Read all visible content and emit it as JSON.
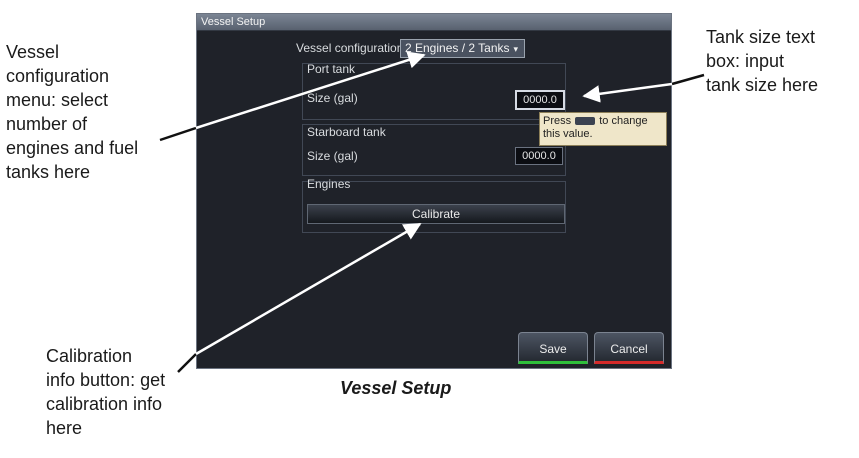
{
  "screen": {
    "title": "Vessel Setup",
    "config_label": "Vessel configuration",
    "config_value": "2 Engines / 2 Tanks",
    "port_tank_label": "Port tank",
    "port_size_label": "Size (gal)",
    "port_size_value": "0000.0",
    "tooltip_pre": "Press",
    "tooltip_post": "to change this value.",
    "starboard_tank_label": "Starboard tank",
    "starboard_size_label": "Size (gal)",
    "starboard_size_value": "0000.0",
    "engines_label": "Engines",
    "calibrate_label": "Calibrate",
    "save_label": "Save",
    "cancel_label": "Cancel"
  },
  "callouts": {
    "left": "Vessel\nconfiguration\nmenu: select\nnumber of\nengines and fuel\ntanks here",
    "right": "Tank size text\nbox: input\ntank size here",
    "bottom": "Calibration\ninfo button: get\ncalibration info\nhere"
  },
  "caption": "Vessel Setup",
  "colors": {
    "screen_bg": "#1f2229",
    "save_accent": "#2fbf3b",
    "cancel_accent": "#d42a2a",
    "tooltip_bg": "#efe6c9"
  },
  "icons": [
    "chevron-down-icon",
    "key-icon",
    "arrow-icon"
  ]
}
